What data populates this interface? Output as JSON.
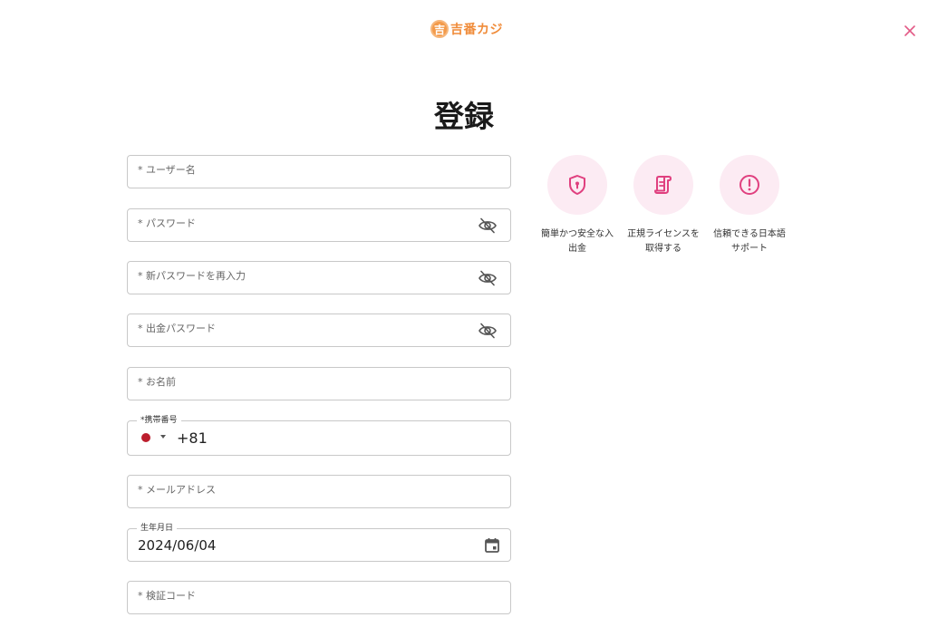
{
  "brand": {
    "logo_mark": "吉",
    "logo_text": "吉番カジ",
    "accent": "#f08c3a"
  },
  "close_icon": "close-icon",
  "title": "登録",
  "form": {
    "username": {
      "placeholder": "* ユーザー名"
    },
    "password": {
      "placeholder": "* パスワード",
      "icon": "eye-off-icon"
    },
    "password_confirm": {
      "placeholder": "* 新パスワードを再入力",
      "icon": "eye-off-icon"
    },
    "withdraw_password": {
      "placeholder": "* 出金パスワード",
      "icon": "eye-off-icon"
    },
    "name": {
      "placeholder": "* お名前"
    },
    "phone": {
      "legend": "*携帯番号",
      "country_code": "+81",
      "flag": "japan-flag"
    },
    "email": {
      "placeholder": "* メールアドレス"
    },
    "birthday": {
      "legend": "生年月日",
      "value": "2024/06/04",
      "icon": "calendar-icon"
    },
    "verification_code": {
      "placeholder": "* 検証コード"
    }
  },
  "features": [
    {
      "icon": "shield-icon",
      "label": "簡単かつ安全な入\n出金"
    },
    {
      "icon": "certificate-icon",
      "label": "正規ライセンスを\n取得する"
    },
    {
      "icon": "alert-circle-icon",
      "label": "信頼できる日本語\nサポート"
    }
  ],
  "colors": {
    "feature_icon": "#e0407f",
    "feature_bg": "#fcebf3",
    "close": "#e35a86"
  }
}
